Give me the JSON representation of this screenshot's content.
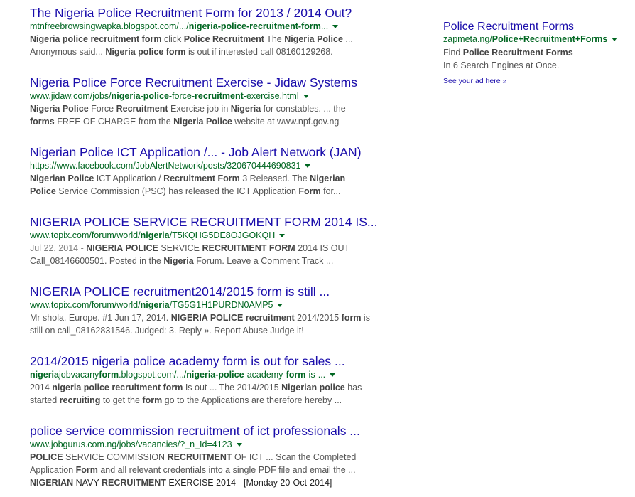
{
  "results": [
    {
      "title": "The Nigeria Police Recruitment Form for 2013 / 2014 Out?",
      "url": [
        {
          "t": "mtnfreebrowsingwapka.blogspot.com/.../",
          "b": false
        },
        {
          "t": "nigeria-police-recruitment-form",
          "b": true
        },
        {
          "t": "...",
          "b": false
        }
      ],
      "snippet": [
        [
          {
            "t": "Nigeria police recruitment form",
            "b": true
          },
          {
            "t": " click ",
            "b": false
          },
          {
            "t": "Police Recruitment",
            "b": true
          },
          {
            "t": " The ",
            "b": false
          },
          {
            "t": "Nigeria Police",
            "b": true
          },
          {
            "t": " ...",
            "b": false
          }
        ],
        [
          {
            "t": "Anonymous said... ",
            "b": false
          },
          {
            "t": "Nigeria police form",
            "b": true
          },
          {
            "t": " is out if interested call 08160129268.",
            "b": false
          }
        ]
      ]
    },
    {
      "title": "Nigeria Police Force Recruitment Exercise - Jidaw Systems",
      "url": [
        {
          "t": "www.jidaw.com/jobs/",
          "b": false
        },
        {
          "t": "nigeria-police",
          "b": true
        },
        {
          "t": "-force-",
          "b": false
        },
        {
          "t": "recruitment",
          "b": true
        },
        {
          "t": "-exercise.html",
          "b": false
        }
      ],
      "snippet": [
        [
          {
            "t": "Nigeria Police",
            "b": true
          },
          {
            "t": " Force ",
            "b": false
          },
          {
            "t": "Recruitment",
            "b": true
          },
          {
            "t": " Exercise job in ",
            "b": false
          },
          {
            "t": "Nigeria",
            "b": true
          },
          {
            "t": " for constables. ... the",
            "b": false
          }
        ],
        [
          {
            "t": "forms",
            "b": true
          },
          {
            "t": " FREE OF CHARGE from the ",
            "b": false
          },
          {
            "t": "Nigeria Police",
            "b": true
          },
          {
            "t": " website at www.npf.gov.ng",
            "b": false
          }
        ]
      ]
    },
    {
      "title": "Nigerian Police ICT Application /... - Job Alert Network (JAN)",
      "url": [
        {
          "t": "https://www.facebook.com/JobAlertNetwork/posts/320670444690831",
          "b": false
        }
      ],
      "snippet": [
        [
          {
            "t": "Nigerian Police",
            "b": true
          },
          {
            "t": " ICT Application / ",
            "b": false
          },
          {
            "t": "Recruitment Form",
            "b": true
          },
          {
            "t": " 3 Released. The ",
            "b": false
          },
          {
            "t": "Nigerian",
            "b": true
          }
        ],
        [
          {
            "t": "Police",
            "b": true
          },
          {
            "t": " Service Commission (PSC) has released the ICT Application ",
            "b": false
          },
          {
            "t": "Form",
            "b": true
          },
          {
            "t": " for...",
            "b": false
          }
        ]
      ]
    },
    {
      "title": "NIGERIA POLICE SERVICE RECRUITMENT FORM 2014 IS...",
      "url": [
        {
          "t": "www.topix.com/forum/world/",
          "b": false
        },
        {
          "t": "nigeria",
          "b": true
        },
        {
          "t": "/T5KQHG5DE8OJGOKQH",
          "b": false
        }
      ],
      "date": "Jul 22, 2014 - ",
      "snippet": [
        [
          {
            "t": "NIGERIA POLICE",
            "b": true
          },
          {
            "t": " SERVICE ",
            "b": false
          },
          {
            "t": "RECRUITMENT FORM",
            "b": true
          },
          {
            "t": " 2014 IS OUT",
            "b": false
          }
        ],
        [
          {
            "t": "Call_08146600501. Posted in the ",
            "b": false
          },
          {
            "t": "Nigeria",
            "b": true
          },
          {
            "t": " Forum. Leave a Comment Track ...",
            "b": false
          }
        ]
      ]
    },
    {
      "title": "NIGERIA POLICE recruitment2014/2015 form is still ...",
      "url": [
        {
          "t": "www.topix.com/forum/world/",
          "b": false
        },
        {
          "t": "nigeria",
          "b": true
        },
        {
          "t": "/TG5G1H1PURDN0AMP5",
          "b": false
        }
      ],
      "snippet": [
        [
          {
            "t": "Mr shola. Europe. #1 Jun 17, 2014. ",
            "b": false
          },
          {
            "t": "NIGERIA POLICE recruitment",
            "b": true
          },
          {
            "t": " 2014/2015 ",
            "b": false
          },
          {
            "t": "form",
            "b": true
          },
          {
            "t": " is",
            "b": false
          }
        ],
        [
          {
            "t": "still on call_08162831546. Judged: 3. Reply ». Report Abuse Judge it!",
            "b": false
          }
        ]
      ]
    },
    {
      "title": "2014/2015 nigeria police academy form is out for sales ...",
      "url": [
        {
          "t": "nigeria",
          "b": true
        },
        {
          "t": "jobvacany",
          "b": false
        },
        {
          "t": "form",
          "b": true
        },
        {
          "t": ".blogspot.com/.../",
          "b": false
        },
        {
          "t": "nigeria-police",
          "b": true
        },
        {
          "t": "-academy-",
          "b": false
        },
        {
          "t": "form",
          "b": true
        },
        {
          "t": "-is-...",
          "b": false
        }
      ],
      "snippet": [
        [
          {
            "t": "2014 ",
            "b": false
          },
          {
            "t": "nigeria police recruitment form",
            "b": true
          },
          {
            "t": " Is out ... The 2014/2015 ",
            "b": false
          },
          {
            "t": "Nigerian police",
            "b": true
          },
          {
            "t": " has",
            "b": false
          }
        ],
        [
          {
            "t": "started ",
            "b": false
          },
          {
            "t": "recruiting",
            "b": true
          },
          {
            "t": " to get the ",
            "b": false
          },
          {
            "t": "form",
            "b": true
          },
          {
            "t": " go to the Applications are therefore hereby ...",
            "b": false
          }
        ]
      ]
    },
    {
      "title": "police service commission recruitment of ict professionals ...",
      "url": [
        {
          "t": "www.jobgurus.com.ng/jobs/vacancies/?_n_Id=4123",
          "b": false
        }
      ],
      "snippet": [
        [
          {
            "t": "POLICE",
            "b": true
          },
          {
            "t": " SERVICE COMMISSION ",
            "b": false
          },
          {
            "t": "RECRUITMENT",
            "b": true
          },
          {
            "t": " OF ICT ... Scan the Completed",
            "b": false
          }
        ],
        [
          {
            "t": "Application ",
            "b": false
          },
          {
            "t": "Form",
            "b": true
          },
          {
            "t": " and all relevant credentials into a single PDF file and email the ...",
            "b": false
          }
        ]
      ],
      "extra": [
        {
          "t": "NIGERIAN",
          "b": true
        },
        {
          "t": " NAVY ",
          "b": false
        },
        {
          "t": "RECRUITMENT",
          "b": true
        },
        {
          "t": " EXERCISE 2014 - [Monday 20-Oct-2014]",
          "b": false
        }
      ]
    }
  ],
  "ad": {
    "title": "Police Recruitment Forms",
    "url": [
      {
        "t": "zapmeta.ng/",
        "b": false
      },
      {
        "t": "Police+Recruitment+Forms",
        "b": true
      }
    ],
    "desc": [
      [
        {
          "t": "Find ",
          "b": false
        },
        {
          "t": "Police Recruitment Forms",
          "b": true
        }
      ],
      [
        {
          "t": "In 6 Search Engines at Once.",
          "b": false
        }
      ]
    ],
    "see_ad": "See your ad here »"
  }
}
